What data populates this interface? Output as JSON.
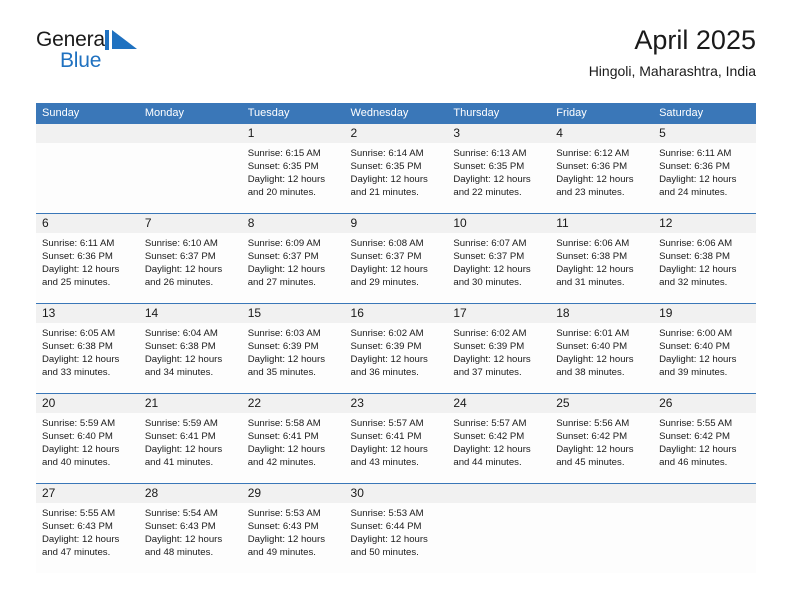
{
  "brand": {
    "name_part1": "General",
    "name_part2": "Blue",
    "mark": "triangle-logo-icon",
    "color_primary": "#1f71c0",
    "color_text": "#1a1a1a"
  },
  "header": {
    "title": "April 2025",
    "subtitle": "Hingoli, Maharashtra, India"
  },
  "theme": {
    "header_row_bg": "#3a77b8",
    "header_row_text": "#ffffff",
    "daynum_band_bg": "#f1f1f1",
    "cell_bg": "#fdfdfd",
    "row_separator": "#3a77b8"
  },
  "calendar": {
    "type": "month-grid",
    "month": "April",
    "year": "2025",
    "weekday_headers": [
      "Sunday",
      "Monday",
      "Tuesday",
      "Wednesday",
      "Thursday",
      "Friday",
      "Saturday"
    ],
    "weeks": [
      [
        {
          "day": "",
          "lines": []
        },
        {
          "day": "",
          "lines": []
        },
        {
          "day": "1",
          "lines": [
            "Sunrise: 6:15 AM",
            "Sunset: 6:35 PM",
            "Daylight: 12 hours",
            "and 20 minutes."
          ]
        },
        {
          "day": "2",
          "lines": [
            "Sunrise: 6:14 AM",
            "Sunset: 6:35 PM",
            "Daylight: 12 hours",
            "and 21 minutes."
          ]
        },
        {
          "day": "3",
          "lines": [
            "Sunrise: 6:13 AM",
            "Sunset: 6:35 PM",
            "Daylight: 12 hours",
            "and 22 minutes."
          ]
        },
        {
          "day": "4",
          "lines": [
            "Sunrise: 6:12 AM",
            "Sunset: 6:36 PM",
            "Daylight: 12 hours",
            "and 23 minutes."
          ]
        },
        {
          "day": "5",
          "lines": [
            "Sunrise: 6:11 AM",
            "Sunset: 6:36 PM",
            "Daylight: 12 hours",
            "and 24 minutes."
          ]
        }
      ],
      [
        {
          "day": "6",
          "lines": [
            "Sunrise: 6:11 AM",
            "Sunset: 6:36 PM",
            "Daylight: 12 hours",
            "and 25 minutes."
          ]
        },
        {
          "day": "7",
          "lines": [
            "Sunrise: 6:10 AM",
            "Sunset: 6:37 PM",
            "Daylight: 12 hours",
            "and 26 minutes."
          ]
        },
        {
          "day": "8",
          "lines": [
            "Sunrise: 6:09 AM",
            "Sunset: 6:37 PM",
            "Daylight: 12 hours",
            "and 27 minutes."
          ]
        },
        {
          "day": "9",
          "lines": [
            "Sunrise: 6:08 AM",
            "Sunset: 6:37 PM",
            "Daylight: 12 hours",
            "and 29 minutes."
          ]
        },
        {
          "day": "10",
          "lines": [
            "Sunrise: 6:07 AM",
            "Sunset: 6:37 PM",
            "Daylight: 12 hours",
            "and 30 minutes."
          ]
        },
        {
          "day": "11",
          "lines": [
            "Sunrise: 6:06 AM",
            "Sunset: 6:38 PM",
            "Daylight: 12 hours",
            "and 31 minutes."
          ]
        },
        {
          "day": "12",
          "lines": [
            "Sunrise: 6:06 AM",
            "Sunset: 6:38 PM",
            "Daylight: 12 hours",
            "and 32 minutes."
          ]
        }
      ],
      [
        {
          "day": "13",
          "lines": [
            "Sunrise: 6:05 AM",
            "Sunset: 6:38 PM",
            "Daylight: 12 hours",
            "and 33 minutes."
          ]
        },
        {
          "day": "14",
          "lines": [
            "Sunrise: 6:04 AM",
            "Sunset: 6:38 PM",
            "Daylight: 12 hours",
            "and 34 minutes."
          ]
        },
        {
          "day": "15",
          "lines": [
            "Sunrise: 6:03 AM",
            "Sunset: 6:39 PM",
            "Daylight: 12 hours",
            "and 35 minutes."
          ]
        },
        {
          "day": "16",
          "lines": [
            "Sunrise: 6:02 AM",
            "Sunset: 6:39 PM",
            "Daylight: 12 hours",
            "and 36 minutes."
          ]
        },
        {
          "day": "17",
          "lines": [
            "Sunrise: 6:02 AM",
            "Sunset: 6:39 PM",
            "Daylight: 12 hours",
            "and 37 minutes."
          ]
        },
        {
          "day": "18",
          "lines": [
            "Sunrise: 6:01 AM",
            "Sunset: 6:40 PM",
            "Daylight: 12 hours",
            "and 38 minutes."
          ]
        },
        {
          "day": "19",
          "lines": [
            "Sunrise: 6:00 AM",
            "Sunset: 6:40 PM",
            "Daylight: 12 hours",
            "and 39 minutes."
          ]
        }
      ],
      [
        {
          "day": "20",
          "lines": [
            "Sunrise: 5:59 AM",
            "Sunset: 6:40 PM",
            "Daylight: 12 hours",
            "and 40 minutes."
          ]
        },
        {
          "day": "21",
          "lines": [
            "Sunrise: 5:59 AM",
            "Sunset: 6:41 PM",
            "Daylight: 12 hours",
            "and 41 minutes."
          ]
        },
        {
          "day": "22",
          "lines": [
            "Sunrise: 5:58 AM",
            "Sunset: 6:41 PM",
            "Daylight: 12 hours",
            "and 42 minutes."
          ]
        },
        {
          "day": "23",
          "lines": [
            "Sunrise: 5:57 AM",
            "Sunset: 6:41 PM",
            "Daylight: 12 hours",
            "and 43 minutes."
          ]
        },
        {
          "day": "24",
          "lines": [
            "Sunrise: 5:57 AM",
            "Sunset: 6:42 PM",
            "Daylight: 12 hours",
            "and 44 minutes."
          ]
        },
        {
          "day": "25",
          "lines": [
            "Sunrise: 5:56 AM",
            "Sunset: 6:42 PM",
            "Daylight: 12 hours",
            "and 45 minutes."
          ]
        },
        {
          "day": "26",
          "lines": [
            "Sunrise: 5:55 AM",
            "Sunset: 6:42 PM",
            "Daylight: 12 hours",
            "and 46 minutes."
          ]
        }
      ],
      [
        {
          "day": "27",
          "lines": [
            "Sunrise: 5:55 AM",
            "Sunset: 6:43 PM",
            "Daylight: 12 hours",
            "and 47 minutes."
          ]
        },
        {
          "day": "28",
          "lines": [
            "Sunrise: 5:54 AM",
            "Sunset: 6:43 PM",
            "Daylight: 12 hours",
            "and 48 minutes."
          ]
        },
        {
          "day": "29",
          "lines": [
            "Sunrise: 5:53 AM",
            "Sunset: 6:43 PM",
            "Daylight: 12 hours",
            "and 49 minutes."
          ]
        },
        {
          "day": "30",
          "lines": [
            "Sunrise: 5:53 AM",
            "Sunset: 6:44 PM",
            "Daylight: 12 hours",
            "and 50 minutes."
          ]
        },
        {
          "day": "",
          "lines": []
        },
        {
          "day": "",
          "lines": []
        },
        {
          "day": "",
          "lines": []
        }
      ]
    ]
  }
}
